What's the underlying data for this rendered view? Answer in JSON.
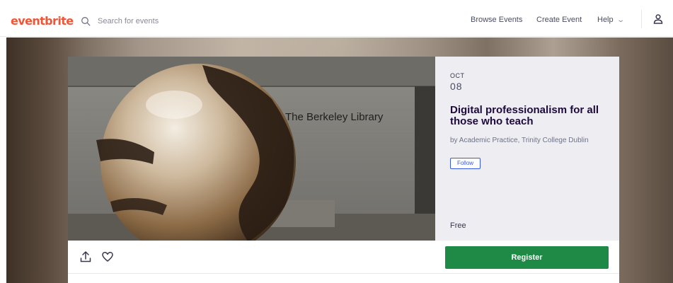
{
  "header": {
    "logo": "eventbrite",
    "search_placeholder": "Search for events",
    "nav": {
      "browse": "Browse Events",
      "create": "Create Event",
      "help": "Help"
    }
  },
  "event": {
    "image_caption": "The Berkeley Library",
    "month": "OCT",
    "day": "08",
    "title": "Digital professionalism for all those who teach",
    "organizer": "by Academic Practice, Trinity College Dublin",
    "follow_label": "Follow",
    "price": "Free"
  },
  "actions": {
    "register_label": "Register"
  },
  "colors": {
    "brand": "#f05537",
    "register": "#1e8a45",
    "follow": "#3659e3"
  },
  "icons": [
    "search-icon",
    "chevron-down-icon",
    "user-icon",
    "share-icon",
    "heart-icon"
  ]
}
